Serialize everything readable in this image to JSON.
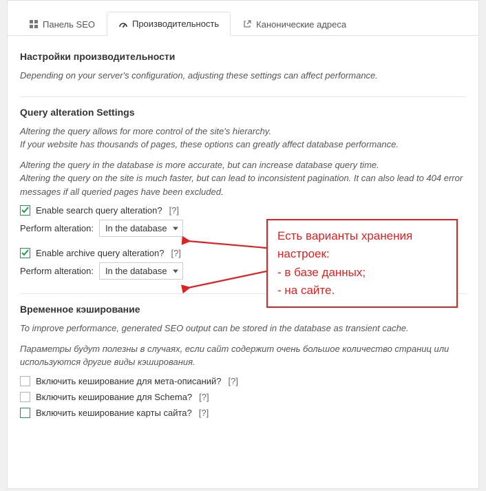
{
  "tabs": {
    "seo_panel": "Панель SEO",
    "performance": "Производительность",
    "canonical": "Канонические адреса"
  },
  "perf": {
    "heading": "Настройки производительности",
    "subtext": "Depending on your server's configuration, adjusting these settings can affect performance."
  },
  "query": {
    "heading": "Query alteration Settings",
    "p1": "Altering the query allows for more control of the site's hierarchy.",
    "p2": "If your website has thousands of pages, these options can greatly affect database performance.",
    "p3": "Altering the query in the database is more accurate, but can increase database query time.",
    "p4": "Altering the query on the site is much faster, but can lead to inconsistent pagination. It can also lead to 404 error messages if all queried pages have been excluded.",
    "enable_search": "Enable search query alteration?",
    "enable_archive": "Enable archive query alteration?",
    "perform_label": "Perform alteration:",
    "select_value": "In the database",
    "help": "[?]"
  },
  "cache": {
    "heading": "Временное кэширование",
    "p1": "To improve performance, generated SEO output can be stored in the database as transient cache.",
    "p2": "Параметры будут полезны в случаях, если сайт содержит очень большое количество страниц или используются другие виды кэширования.",
    "cb_meta": "Включить кеширование для мета-описаний?",
    "cb_schema": "Включить кеширование для Schema?",
    "cb_sitemap": "Включить кеширование карты сайта?",
    "help": "[?]"
  },
  "annotation": {
    "l1": "Есть варианты хранения",
    "l2": "настроек:",
    "l3": "- в базе данных;",
    "l4": "- на сайте."
  }
}
